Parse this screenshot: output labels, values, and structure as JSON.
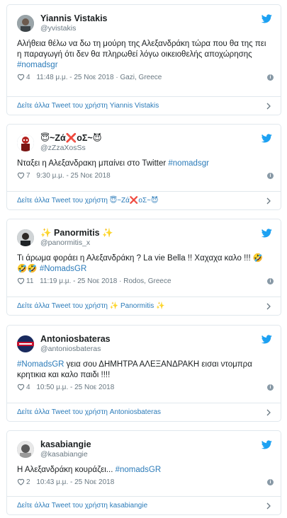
{
  "tweets": [
    {
      "display_name": "Yiannis Vistakis",
      "handle": "@yvistakis",
      "text": "Αλήθεια θέλω να δω τη μούρη της Αλεξανδράκη τώρα που θα της πει η παραγωγή ότι δεν θα πληρωθεί λόγω  οικειοθελής αποχώρησης ",
      "hashtag": "#nomadsgr",
      "likes": "4",
      "time": "11:48 μ.μ. - 25 Νοε 2018",
      "location": "Gazi, Greece",
      "more_link": "Δείτε άλλα Tweet του χρήστη Yiannis Vistakis"
    },
    {
      "display_name": "😇~Zά❌oΣ~😈",
      "handle": "@zZzaXosSs",
      "text": "Νταξει η Αλεξανδρακη μπαίνει στο Twitter ",
      "hashtag": "#nomadsgr",
      "likes": "7",
      "time": "9:30 μ.μ. - 25 Νοε 2018",
      "location": "",
      "more_link": "Δείτε άλλα Tweet του χρήστη 😇~Zά❌oΣ~😈"
    },
    {
      "display_name": "✨ Panormitis ✨",
      "handle": "@panormitis_x",
      "text": "Τι άρωμα φοράει η Αλεξανδράκη ? La vie Bella !!  Χαχαχα καλο !!! 🤣🤣🤣 ",
      "hashtag": "#NomadsGR",
      "likes": "11",
      "time": "11:19 μ.μ. - 25 Νοε 2018",
      "location": "Rodos, Greece",
      "more_link": "Δείτε άλλα Tweet του χρήστη ✨ Panormitis ✨"
    },
    {
      "display_name": "Antoniosbateras",
      "handle": "@antoniosbateras",
      "hashtag": "#NomadsGR",
      "text": " γεια σου ΔΗΜΗΤΡΑ ΑΛΕΞΑΝΔΡΑΚΗ εισαι ντομπρα κρητικια και καλο παιδι !!!!",
      "likes": "4",
      "time": "10:50 μ.μ. - 25 Νοε 2018",
      "location": "",
      "more_link": "Δείτε άλλα Tweet του χρήστη Antoniosbateras"
    },
    {
      "display_name": "kasabiangie",
      "handle": "@kasabiangie",
      "text": "Η Αλεξανδράκη κουράζει... ",
      "hashtag": "#nomadsGR",
      "likes": "2",
      "time": "10:43 μ.μ. - 25 Νοε 2018",
      "location": "",
      "more_link": "Δείτε άλλα Tweet του χρήστη kasabiangie"
    }
  ],
  "colors": {
    "link": "#2b7bb9",
    "meta": "#697882",
    "border": "#e1e8ed",
    "twitter_blue": "#1da1f2"
  },
  "icons": {
    "bird": "twitter-bird-icon",
    "heart": "heart-icon",
    "info": "info-icon",
    "chevron": "chevron-right-icon"
  }
}
